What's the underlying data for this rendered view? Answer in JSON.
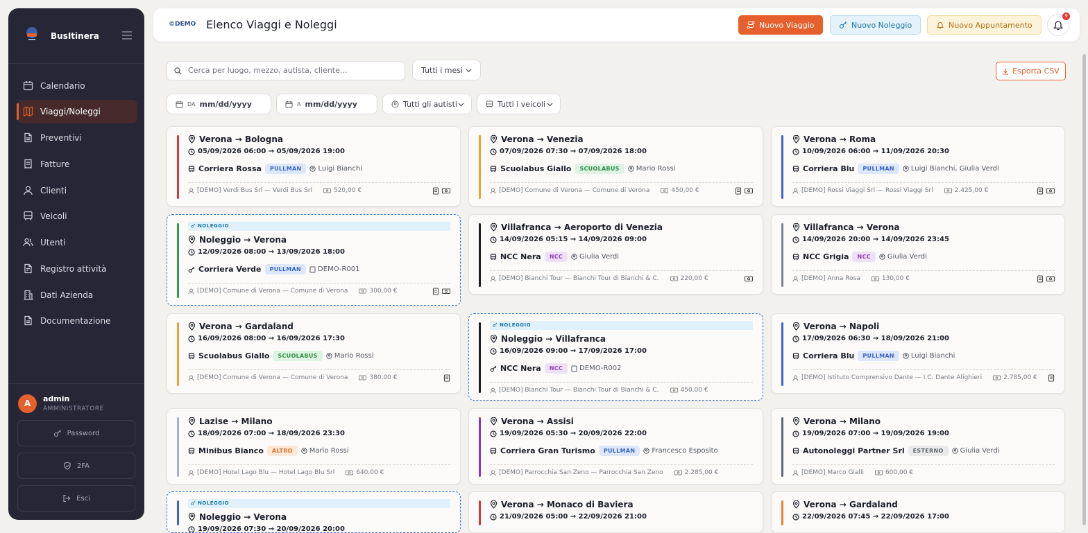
{
  "brand": {
    "name": "BusItinera",
    "demo": "©DEMO"
  },
  "nav": [
    {
      "label": "Calendario",
      "icon": "calendar-icon"
    },
    {
      "label": "Viaggi/Noleggi",
      "icon": "map-icon",
      "active": true
    },
    {
      "label": "Preventivi",
      "icon": "document-icon"
    },
    {
      "label": "Fatture",
      "icon": "receipt-icon"
    },
    {
      "label": "Clienti",
      "icon": "user-icon"
    },
    {
      "label": "Veicoli",
      "icon": "bus-icon"
    },
    {
      "label": "Utenti",
      "icon": "users-icon"
    },
    {
      "label": "Registro attività",
      "icon": "log-icon"
    },
    {
      "label": "Dati Azienda",
      "icon": "building-icon"
    },
    {
      "label": "Documentazione",
      "icon": "docs-icon"
    }
  ],
  "user": {
    "initial": "A",
    "name": "admin",
    "role": "AMMINISTRATORE"
  },
  "user_actions": {
    "password": "Password",
    "twofa": "2FA",
    "logout": "Esci"
  },
  "header": {
    "title": "Elenco Viaggi e Noleggi",
    "new_trip": "Nuovo Viaggio",
    "new_rental": "Nuovo Noleggio",
    "new_appointment": "Nuovo Appuntamento",
    "notifications": "9"
  },
  "filters": {
    "search_placeholder": "Cerca per luogo, mezzo, autista, cliente...",
    "months": "Tutti i mesi",
    "export": "Esporta CSV",
    "from_label": "DA",
    "to_label": "A",
    "date_placeholder": "mm/dd/yyyy",
    "drivers": "Tutti gli autisti",
    "vehicles": "Tutti i veicoli"
  },
  "colors": {
    "accent": "#e5602c",
    "sidebar": "#262637"
  },
  "rental_tag": "NOLEGGIO",
  "cards": [
    {
      "route": "Verona → Bologna",
      "dates": "05/09/2026 06:00 → 05/09/2026 19:00",
      "vehicle": "Corriera Rossa",
      "type": "PULLMAN",
      "driver": "Luigi Bianchi",
      "client": "[DEMO] Verdi Bus Srl — Verdi Bus Srl",
      "price": "520,00 €",
      "color": "#d23b3b"
    },
    {
      "route": "Verona → Venezia",
      "dates": "07/09/2026 07:30 → 07/09/2026 18:00",
      "vehicle": "Scuolabus Giallo",
      "type": "SCUOLABUS",
      "driver": "Mario Rossi",
      "client": "[DEMO] Comune di Verona — Comune di Verona",
      "price": "450,00 €",
      "color": "#e8a530"
    },
    {
      "route": "Verona → Roma",
      "dates": "10/09/2026 06:00 → 11/09/2026 20:30",
      "vehicle": "Corriera Blu",
      "type": "PULLMAN",
      "driver": "Luigi Bianchi, Giulia Verdi",
      "client": "[DEMO] Rossi Viaggi Srl — Rossi Viaggi Srl",
      "price": "2.425,00 €",
      "color": "#3a62d6"
    },
    {
      "route": "Noleggio → Verona",
      "dates": "12/09/2026 08:00 → 13/09/2026 18:00",
      "vehicle": "Corriera Verde",
      "type": "PULLMAN",
      "driver": "DEMO-R001",
      "client": "[DEMO] Comune di Verona — Comune di Verona",
      "price": "300,00 €",
      "color": "#2a9e4a",
      "rental": true
    },
    {
      "route": "Villafranca → Aeroporto di Venezia",
      "dates": "14/09/2026 05:15 → 14/09/2026 09:00",
      "vehicle": "NCC Nera",
      "type": "NCC",
      "driver": "Giulia Verdi",
      "client": "[DEMO] Bianchi Tour — Bianchi Tour di Bianchi & C.",
      "price": "220,00 €",
      "color": "#1d1d22"
    },
    {
      "route": "Villafranca → Verona",
      "dates": "14/09/2026 20:00 → 14/09/2026 23:45",
      "vehicle": "NCC Grigia",
      "type": "NCC",
      "driver": "Giulia Verdi",
      "client": "[DEMO] Anna Rosa",
      "price": "130,00 €",
      "color": "#7b8190"
    },
    {
      "route": "Verona → Gardaland",
      "dates": "16/09/2026 08:00 → 16/09/2026 17:30",
      "vehicle": "Scuolabus Giallo",
      "type": "SCUOLABUS",
      "driver": "Mario Rossi",
      "client": "[DEMO] Comune di Verona — Comune di Verona",
      "price": "380,00 €",
      "color": "#e8a530"
    },
    {
      "route": "Noleggio → Villafranca",
      "dates": "16/09/2026 09:00 → 17/09/2026 17:00",
      "vehicle": "NCC Nera",
      "type": "NCC",
      "driver": "DEMO-R002",
      "client": "[DEMO] Bianchi Tour — Bianchi Tour di Bianchi & C.",
      "price": "450,00 €",
      "color": "#1d1d22",
      "rental": true
    },
    {
      "route": "Verona → Napoli",
      "dates": "17/09/2026 06:30 → 18/09/2026 21:00",
      "vehicle": "Corriera Blu",
      "type": "PULLMAN",
      "driver": "Luigi Bianchi",
      "client": "[DEMO] Istituto Comprensivo Dante — I.C. Dante Alighieri",
      "price": "2.785,00 €",
      "color": "#3a62d6"
    },
    {
      "route": "Lazise → Milano",
      "dates": "18/09/2026 07:00 → 18/09/2026 23:30",
      "vehicle": "Minibus Bianco",
      "type": "ALTRO",
      "driver": "Mario Rossi",
      "client": "[DEMO] Hotel Lago Blu — Hotel Lago Blu Srl",
      "price": "640,00 €",
      "color": "#a9b0bf"
    },
    {
      "route": "Verona → Assisi",
      "dates": "19/09/2026 05:30 → 20/09/2026 22:00",
      "vehicle": "Corriera Gran Turismo",
      "type": "PULLMAN",
      "driver": "Francesco Esposito",
      "client": "[DEMO] Parrocchia San Zeno — Parrocchia San Zeno",
      "price": "2.285,00 €",
      "color": "#7b3fc7"
    },
    {
      "route": "Verona → Milano",
      "dates": "19/09/2026 07:00 → 19/09/2026 19:00",
      "vehicle": "Autonoleggi Partner Srl",
      "type": "ESTERNO",
      "driver": "Giulia Verdi",
      "client": "[DEMO] Marco Gialli",
      "price": "600,00 €",
      "color": "#5f6675"
    },
    {
      "route": "Noleggio → Verona",
      "dates": "19/09/2026 07:30 → 20/09/2026 20:00",
      "color": "#3a62d6",
      "rental": true
    },
    {
      "route": "Verona → Monaco di Baviera",
      "dates": "21/09/2026 05:00 → 22/09/2026 21:00",
      "color": "#d23b3b"
    },
    {
      "route": "Verona → Gardaland",
      "dates": "22/09/2026 07:45 → 22/09/2026 17:00",
      "color": "#e8832c"
    }
  ]
}
